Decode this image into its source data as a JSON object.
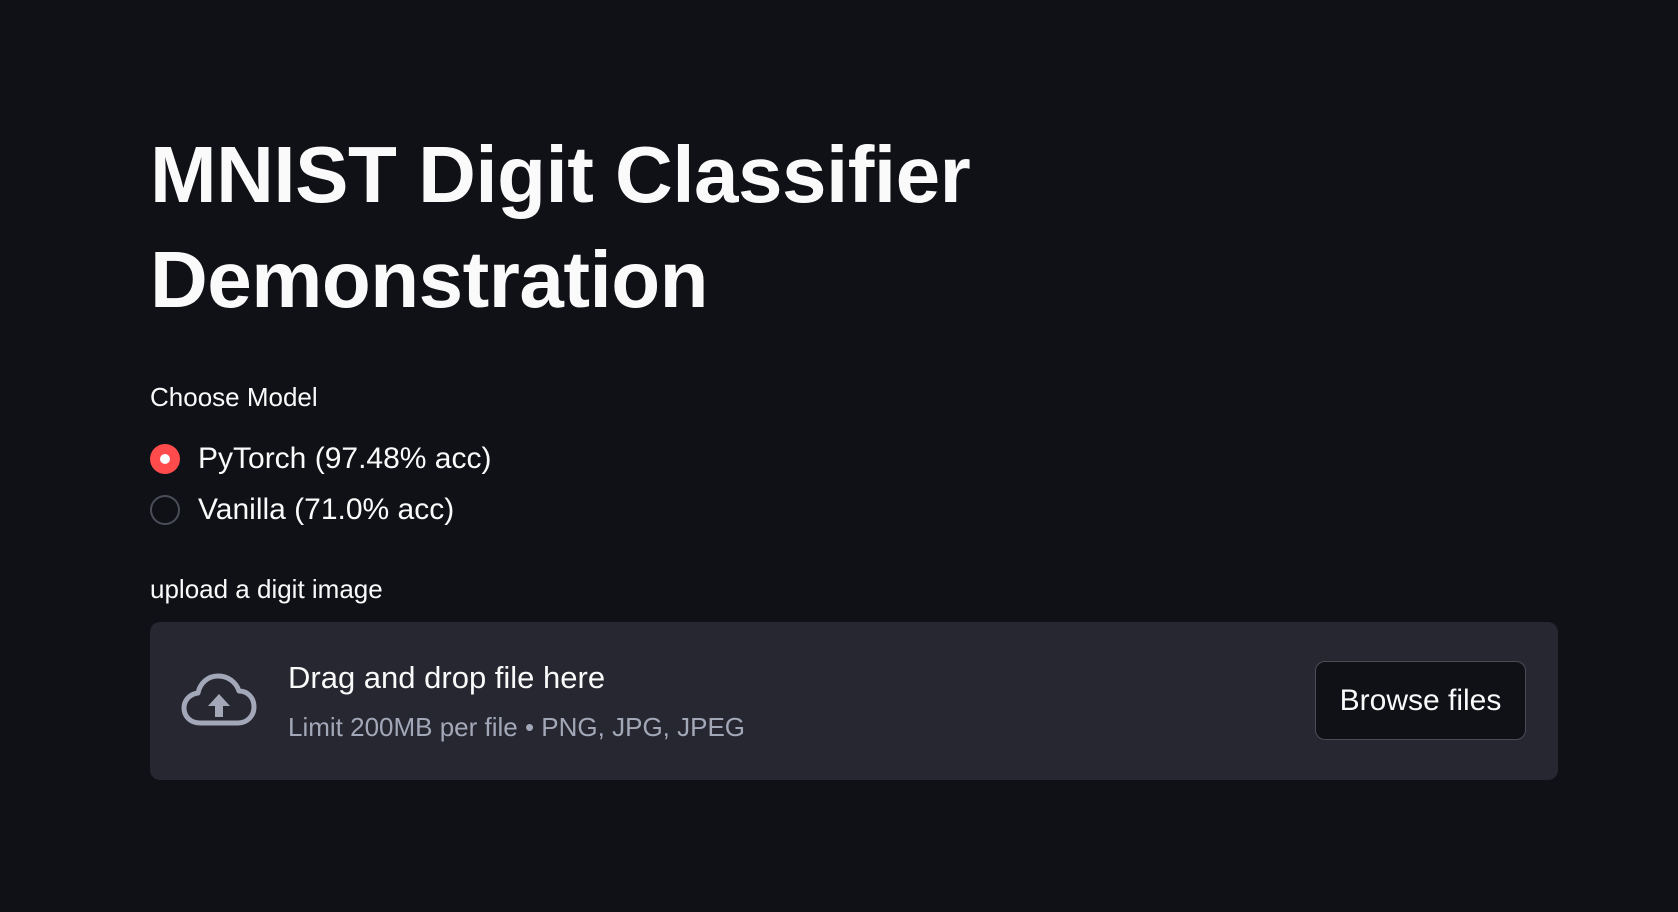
{
  "page": {
    "title": "MNIST Digit Classifier Demonstration"
  },
  "model_select": {
    "label": "Choose Model",
    "options": [
      {
        "label": "PyTorch (97.48% acc)",
        "selected": true
      },
      {
        "label": "Vanilla (71.0% acc)",
        "selected": false
      }
    ]
  },
  "uploader": {
    "label": "upload a digit image",
    "drop_title": "Drag and drop file here",
    "limit_text": "Limit 200MB per file • PNG, JPG, JPEG",
    "browse_label": "Browse files",
    "icon": "cloud-upload-icon"
  },
  "colors": {
    "background": "#0f1117",
    "accent": "#ff4b4b",
    "dropzone": "#262730",
    "text": "#fafafa",
    "muted_text": "#a3a8b8"
  }
}
